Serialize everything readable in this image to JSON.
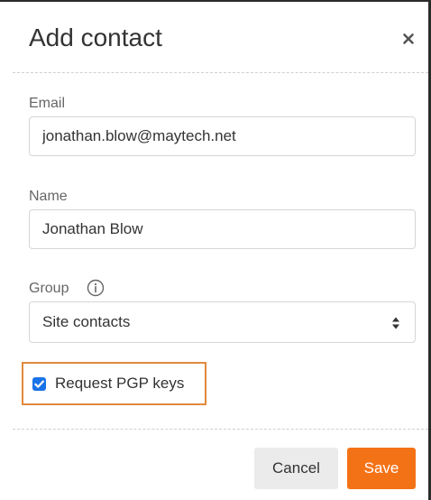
{
  "dialog": {
    "title": "Add contact",
    "close_icon": "close-icon"
  },
  "email": {
    "label": "Email",
    "value": "jonathan.blow@maytech.net"
  },
  "name": {
    "label": "Name",
    "value": "Jonathan Blow"
  },
  "group": {
    "label": "Group",
    "info_icon": "info-icon",
    "selected": "Site contacts",
    "arrow_icon": "sort-arrows-icon"
  },
  "pgp": {
    "label": "Request PGP keys",
    "checked": true
  },
  "footer": {
    "cancel_label": "Cancel",
    "save_label": "Save"
  },
  "colors": {
    "accent": "#f47216",
    "checkbox": "#1a73e8",
    "highlight_border": "#e08a3c"
  }
}
